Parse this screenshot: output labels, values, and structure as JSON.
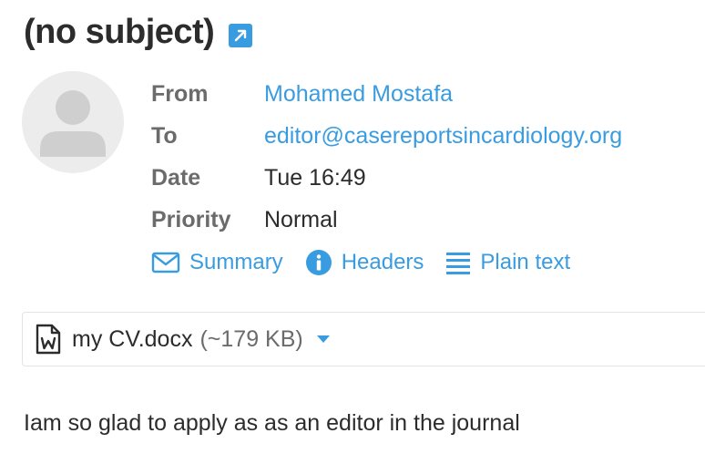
{
  "message": {
    "subject": "(no subject)",
    "from": {
      "label": "From",
      "value": "Mohamed Mostafa"
    },
    "to": {
      "label": "To",
      "value": "editor@casereportsincardiology.org"
    },
    "date": {
      "label": "Date",
      "value": "Tue 16:49"
    },
    "priority": {
      "label": "Priority",
      "value": "Normal"
    },
    "body": "Iam so glad to apply as as an editor in the journal"
  },
  "views": {
    "summary": "Summary",
    "headers": "Headers",
    "plain_text": "Plain text"
  },
  "attachment": {
    "name": "my CV.docx",
    "size": "(~179 KB)",
    "icon": "word-file-icon"
  },
  "colors": {
    "accent": "#3a9ce0",
    "label": "#6b6b6b",
    "text": "#2c2c2c"
  }
}
